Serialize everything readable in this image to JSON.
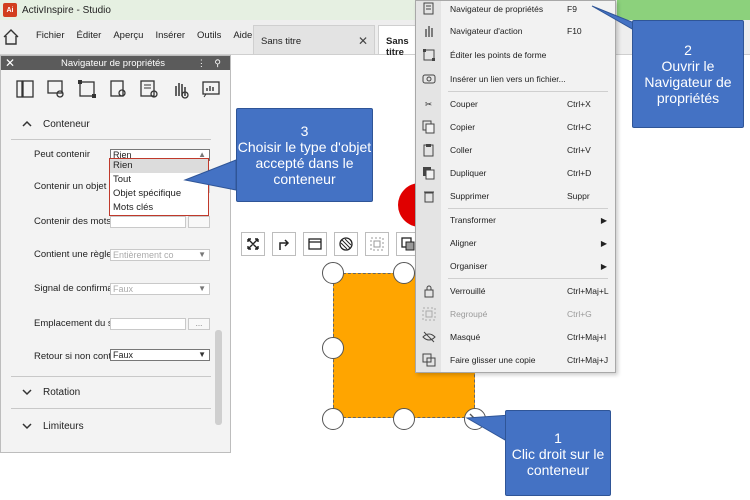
{
  "app": {
    "title": "ActivInspire - Studio",
    "logo_text": "Ai"
  },
  "menubar": {
    "items": [
      "Fichier",
      "Éditer",
      "Aperçu",
      "Insérer",
      "Outils",
      "Aide"
    ],
    "tabs": [
      {
        "label": "Sans titre",
        "active": false
      },
      {
        "label": "Sans titre",
        "active": true
      }
    ]
  },
  "panel": {
    "title": "Navigateur de propriétés",
    "section_container": "Conteneur",
    "properties": [
      {
        "label": "Peut contenir",
        "value": "Rien"
      },
      {
        "label": "Contenir un objet",
        "value": ""
      },
      {
        "label": "Contenir des mots",
        "value": ""
      },
      {
        "label": "Contient une règle",
        "value": "Entièrement co"
      },
      {
        "label": "Signal de confirmation",
        "value": "Faux"
      },
      {
        "label": "Emplacement du son",
        "value": "",
        "button": "..."
      },
      {
        "label": "Retour si non contenu",
        "value": "Faux"
      }
    ],
    "dropdown_options": [
      "Rien",
      "Tout",
      "Objet spécifique",
      "Mots clés"
    ],
    "sections": [
      "Rotation",
      "Limiteurs"
    ]
  },
  "context_menu": {
    "items": [
      {
        "label": "Navigateur de propriétés",
        "shortcut": "F9",
        "icon": "property-browser-icon"
      },
      {
        "label": "Navigateur d'action",
        "shortcut": "F10",
        "icon": "action-browser-icon"
      },
      {
        "label": "Éditer les points de forme",
        "shortcut": "",
        "icon": "edit-shape-points-icon"
      },
      {
        "label": "Insérer un lien vers un fichier...",
        "shortcut": "",
        "icon": "link-file-icon"
      },
      {
        "label": "Couper",
        "shortcut": "Ctrl+X",
        "icon": "scissors-icon"
      },
      {
        "label": "Copier",
        "shortcut": "Ctrl+C",
        "icon": "copy-icon"
      },
      {
        "label": "Coller",
        "shortcut": "Ctrl+V",
        "icon": "paste-icon"
      },
      {
        "label": "Dupliquer",
        "shortcut": "Ctrl+D",
        "icon": "duplicate-icon"
      },
      {
        "label": "Supprimer",
        "shortcut": "Suppr",
        "icon": "trash-icon"
      },
      {
        "label": "Transformer",
        "shortcut": "",
        "icon": "",
        "submenu": true
      },
      {
        "label": "Aligner",
        "shortcut": "",
        "icon": "",
        "submenu": true
      },
      {
        "label": "Organiser",
        "shortcut": "",
        "icon": "",
        "submenu": true
      },
      {
        "label": "Verrouillé",
        "shortcut": "Ctrl+Maj+L",
        "icon": "lock-icon"
      },
      {
        "label": "Regroupé",
        "shortcut": "Ctrl+G",
        "icon": "group-icon",
        "disabled": true
      },
      {
        "label": "Masqué",
        "shortcut": "Ctrl+Maj+I",
        "icon": "hidden-eye-icon"
      },
      {
        "label": "Faire glisser une copie",
        "shortcut": "Ctrl+Maj+J",
        "icon": "drag-copy-icon"
      }
    ]
  },
  "callouts": {
    "c1": {
      "num": "1",
      "text": "Clic droit sur le conteneur"
    },
    "c2": {
      "num": "2",
      "text": "Ouvrir le Navigateur de propriétés"
    },
    "c3": {
      "num": "3",
      "text": "Choisir le type d'objet accepté dans le conteneur"
    }
  },
  "colors": {
    "callout": "#4472c4",
    "shape": "#ffa500",
    "accent_red": "#e00000"
  }
}
